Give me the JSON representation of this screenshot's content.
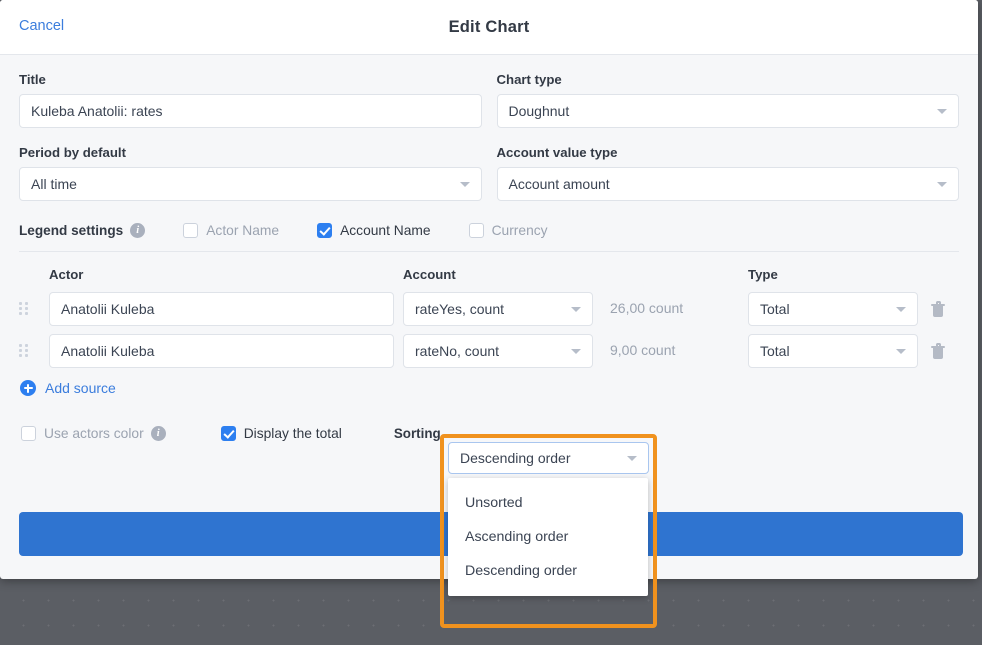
{
  "header": {
    "cancel_label": "Cancel",
    "title": "Edit Chart"
  },
  "form": {
    "title_field": {
      "label": "Title",
      "value": "Kuleba Anatolii: rates"
    },
    "chart_type_field": {
      "label": "Chart type",
      "value": "Doughnut"
    },
    "period_field": {
      "label": "Period by default",
      "value": "All time"
    },
    "account_value_type_field": {
      "label": "Account value type",
      "value": "Account amount"
    }
  },
  "legend_settings": {
    "title": "Legend settings",
    "checkboxes": [
      {
        "label": "Actor Name",
        "checked": false
      },
      {
        "label": "Account Name",
        "checked": true
      },
      {
        "label": "Currency",
        "checked": false
      }
    ]
  },
  "sources_table": {
    "columns": {
      "actor": "Actor",
      "account": "Account",
      "type": "Type"
    },
    "rows": [
      {
        "actor": "Anatolii Kuleba",
        "account": "rateYes, count",
        "value": "26,00 count",
        "type": "Total"
      },
      {
        "actor": "Anatolii Kuleba",
        "account": "rateNo, count",
        "value": "9,00 count",
        "type": "Total"
      }
    ]
  },
  "add_source": {
    "label": "Add source"
  },
  "options": {
    "use_actors_color": {
      "label": "Use actors color",
      "checked": false
    },
    "display_total": {
      "label": "Display the total",
      "checked": true
    },
    "sorting_label": "Sorting"
  },
  "sorting_dropdown": {
    "selected": "Descending order",
    "options": [
      "Unsorted",
      "Ascending order",
      "Descending order"
    ]
  },
  "primary_button": {
    "label": ""
  },
  "colors": {
    "accent_blue": "#2d7ff0",
    "link_blue": "#3b7ddd",
    "primary_button": "#2f74d0",
    "highlight_orange": "#f0921e",
    "backdrop": "#5b5e64"
  }
}
